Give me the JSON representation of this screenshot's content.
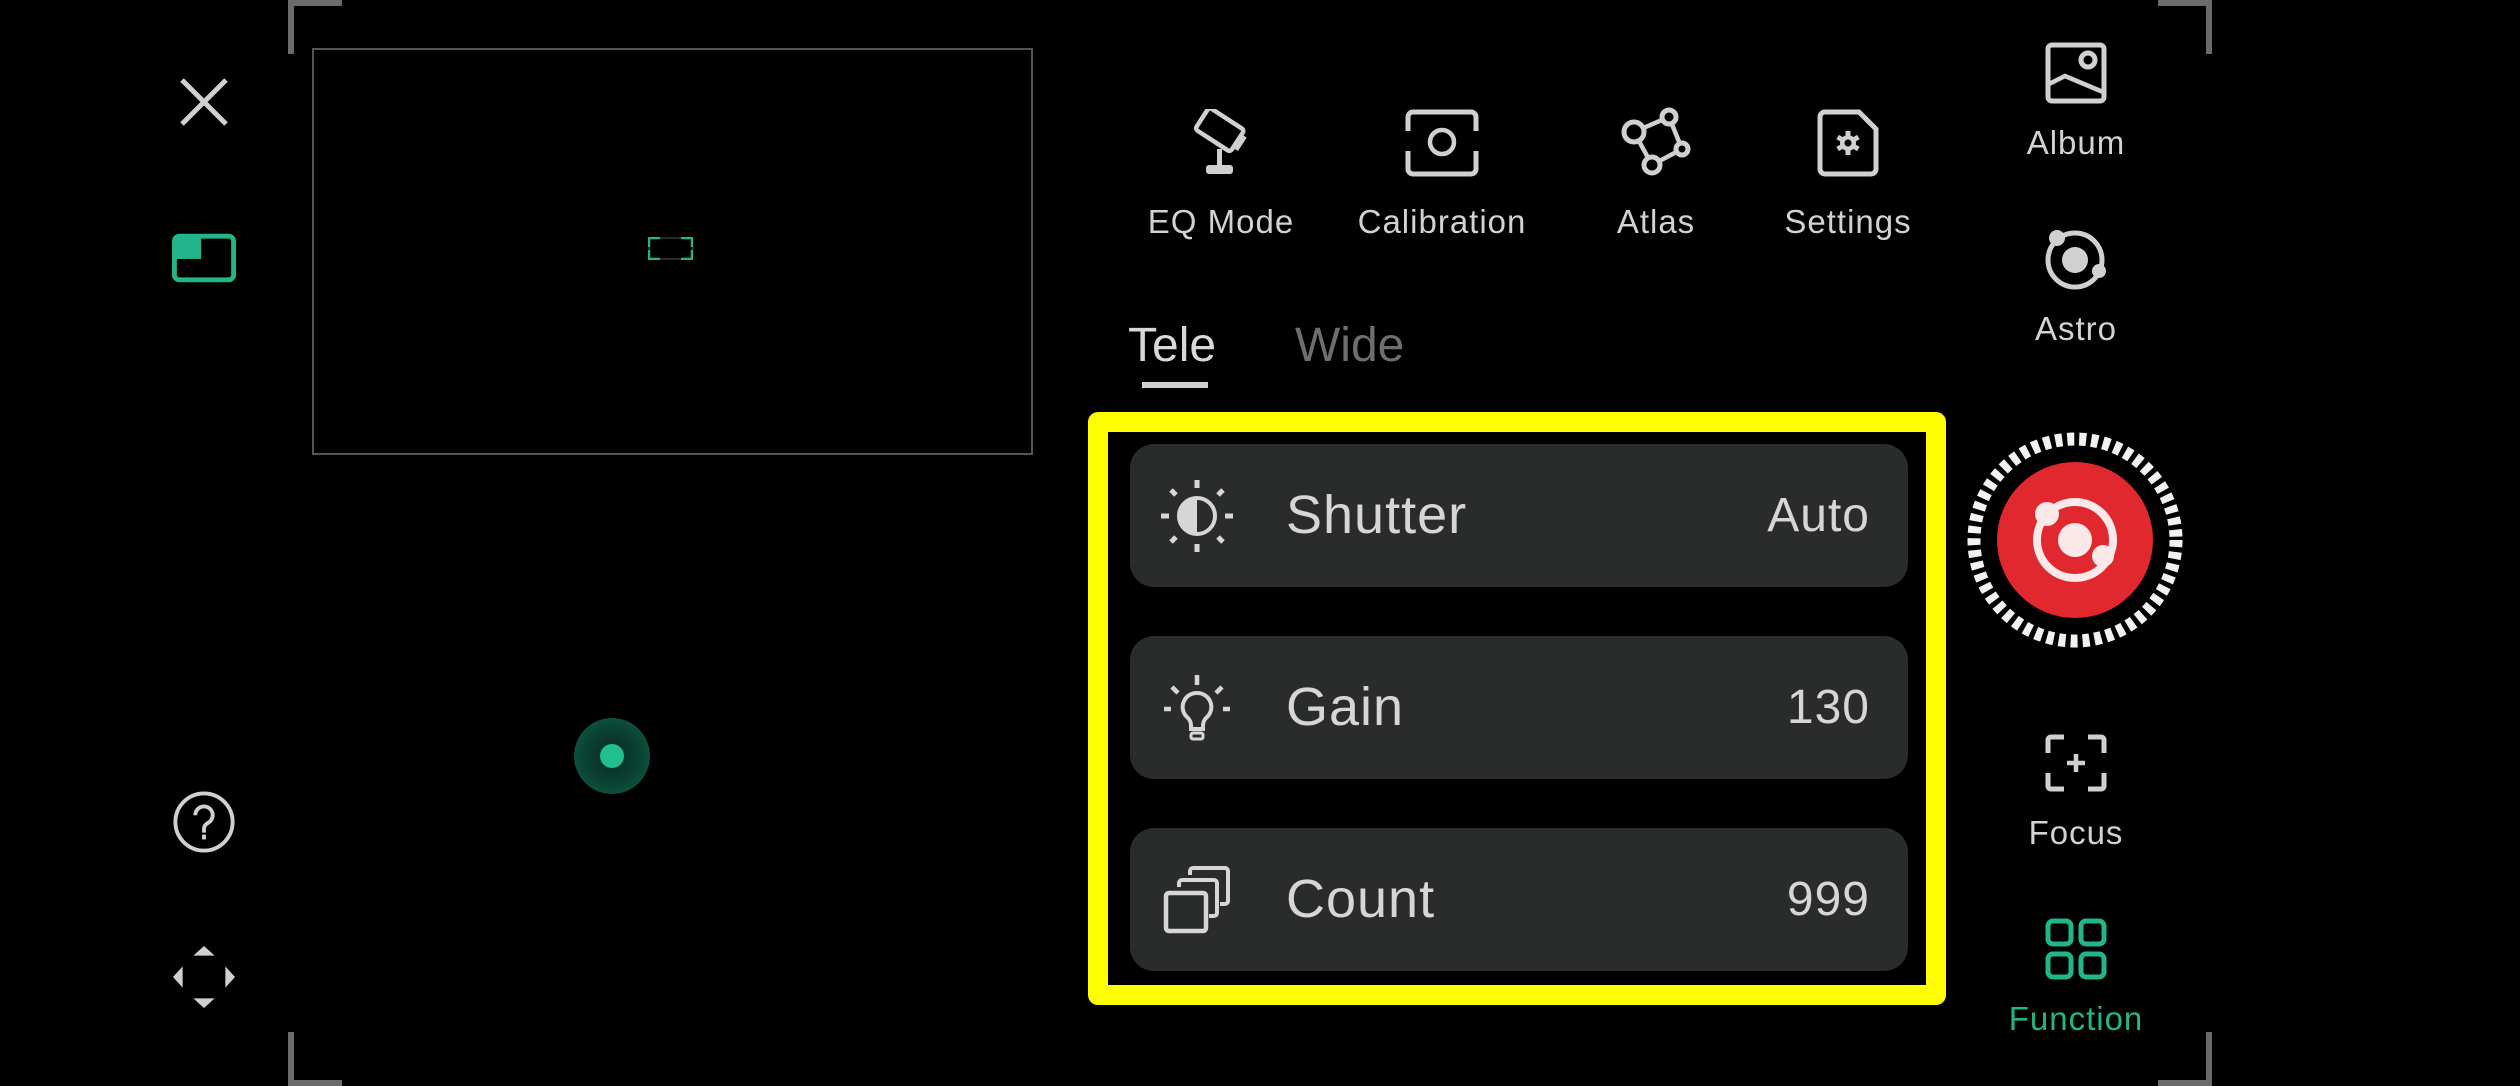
{
  "left_toolbar": {
    "close": {
      "icon": "close-icon"
    },
    "layout": {
      "icon": "picture-in-picture-icon",
      "color": "#22b58a"
    },
    "help": {
      "icon": "help-icon"
    },
    "move": {
      "icon": "move-arrows-icon"
    }
  },
  "preview": {
    "focus_frame_color": "#22b58a"
  },
  "top_tools": [
    {
      "label": "EQ Mode",
      "icon": "telescope-mount-icon"
    },
    {
      "label": "Calibration",
      "icon": "calibration-icon"
    },
    {
      "label": "Atlas",
      "icon": "constellation-icon"
    },
    {
      "label": "Settings",
      "icon": "settings-file-icon"
    }
  ],
  "tabs": [
    {
      "label": "Tele",
      "active": true
    },
    {
      "label": "Wide",
      "active": false
    }
  ],
  "params": [
    {
      "label": "Shutter",
      "value": "Auto",
      "icon": "exposure-icon"
    },
    {
      "label": "Gain",
      "value": "130",
      "icon": "bulb-icon"
    },
    {
      "label": "Count",
      "value": "999",
      "icon": "stack-icon"
    }
  ],
  "right_bar": {
    "album": {
      "label": "Album",
      "icon": "image-icon"
    },
    "astro": {
      "label": "Astro",
      "icon": "astro-orbit-icon"
    },
    "shutter_button": {
      "icon": "astro-shutter-icon",
      "color": "#e0282e"
    },
    "focus": {
      "label": "Focus",
      "icon": "focus-icon"
    },
    "function": {
      "label": "Function",
      "icon": "grid-icon",
      "active": true,
      "color": "#22b58a"
    }
  },
  "highlight_color": "#ffff00"
}
